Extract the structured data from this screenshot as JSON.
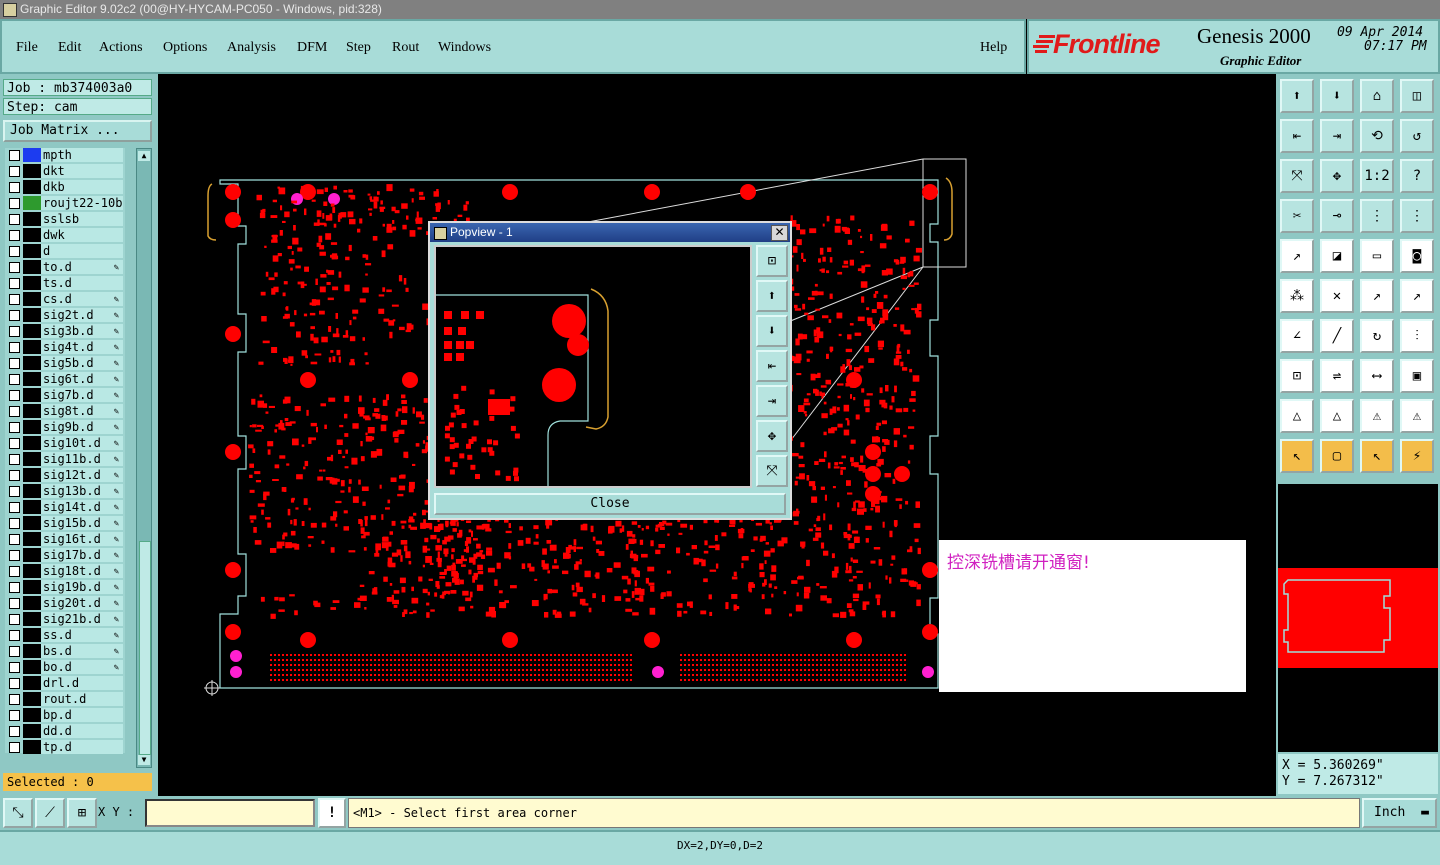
{
  "window": {
    "title": "Graphic Editor 9.02c2 (00@HY-HYCAM-PC050 - Windows, pid:328)"
  },
  "menu": {
    "file": "File",
    "edit": "Edit",
    "actions": "Actions",
    "options": "Options",
    "analysis": "Analysis",
    "dfm": "DFM",
    "step": "Step",
    "rout": "Rout",
    "windows": "Windows",
    "help": "Help"
  },
  "brand": {
    "logo": "Frontline",
    "product": "Genesis 2000",
    "subtitle": "Graphic Editor",
    "date": "09 Apr 2014",
    "time": "07:17 PM"
  },
  "left": {
    "job": "Job : mb374003a0",
    "step": "Step: cam",
    "job_matrix": "Job Matrix ...",
    "selected": "Selected : 0"
  },
  "layers": [
    {
      "name": "mpth",
      "color": "#1c3cf0",
      "pen": false
    },
    {
      "name": "dkt",
      "color": "#000000",
      "pen": false
    },
    {
      "name": "dkb",
      "color": "#000000",
      "pen": false
    },
    {
      "name": "roujt22-10b",
      "color": "#2e9a2e",
      "pen": false
    },
    {
      "name": "sslsb",
      "color": "#000000",
      "pen": false
    },
    {
      "name": "dwk",
      "color": "#000000",
      "pen": false
    },
    {
      "name": "d",
      "color": "#000000",
      "pen": false
    },
    {
      "name": "to.d",
      "color": "#000000",
      "pen": true
    },
    {
      "name": "ts.d",
      "color": "#000000",
      "pen": false
    },
    {
      "name": "cs.d",
      "color": "#000000",
      "pen": true
    },
    {
      "name": "sig2t.d",
      "color": "#000000",
      "pen": true
    },
    {
      "name": "sig3b.d",
      "color": "#000000",
      "pen": true
    },
    {
      "name": "sig4t.d",
      "color": "#000000",
      "pen": true
    },
    {
      "name": "sig5b.d",
      "color": "#000000",
      "pen": true
    },
    {
      "name": "sig6t.d",
      "color": "#000000",
      "pen": true
    },
    {
      "name": "sig7b.d",
      "color": "#000000",
      "pen": true
    },
    {
      "name": "sig8t.d",
      "color": "#000000",
      "pen": true
    },
    {
      "name": "sig9b.d",
      "color": "#000000",
      "pen": true
    },
    {
      "name": "sig10t.d",
      "color": "#000000",
      "pen": true
    },
    {
      "name": "sig11b.d",
      "color": "#000000",
      "pen": true
    },
    {
      "name": "sig12t.d",
      "color": "#000000",
      "pen": true
    },
    {
      "name": "sig13b.d",
      "color": "#000000",
      "pen": true
    },
    {
      "name": "sig14t.d",
      "color": "#000000",
      "pen": true
    },
    {
      "name": "sig15b.d",
      "color": "#000000",
      "pen": true
    },
    {
      "name": "sig16t.d",
      "color": "#000000",
      "pen": true
    },
    {
      "name": "sig17b.d",
      "color": "#000000",
      "pen": true
    },
    {
      "name": "sig18t.d",
      "color": "#000000",
      "pen": true
    },
    {
      "name": "sig19b.d",
      "color": "#000000",
      "pen": true
    },
    {
      "name": "sig20t.d",
      "color": "#000000",
      "pen": true
    },
    {
      "name": "sig21b.d",
      "color": "#000000",
      "pen": true
    },
    {
      "name": "ss.d",
      "color": "#000000",
      "pen": true
    },
    {
      "name": "bs.d",
      "color": "#000000",
      "pen": true
    },
    {
      "name": "bo.d",
      "color": "#000000",
      "pen": true
    },
    {
      "name": "drl.d",
      "color": "#000000",
      "pen": false
    },
    {
      "name": "rout.d",
      "color": "#000000",
      "pen": false
    },
    {
      "name": "bp.d",
      "color": "#000000",
      "pen": false
    },
    {
      "name": "dd.d",
      "color": "#000000",
      "pen": false
    },
    {
      "name": "tp.d",
      "color": "#000000",
      "pen": false
    }
  ],
  "popview": {
    "title": "Popview - 1",
    "close": "Close"
  },
  "message": {
    "text": "控深铣槽请开通窗!"
  },
  "coords": {
    "x": "X = 5.360269\"",
    "y": "Y = 7.267312\""
  },
  "bottom": {
    "xy_label": "X Y :",
    "xy_value": "",
    "prompt": "<M1> - Select first area corner",
    "unit": "Inch"
  },
  "status": {
    "text": "DX=2,DY=0,D=2"
  },
  "colors": {
    "pad": "#ff0000",
    "outline": "#9fe0dc",
    "magenta": "#ff20d0",
    "panel": "#a8dcd8",
    "highlight": "#f3bd4a"
  }
}
